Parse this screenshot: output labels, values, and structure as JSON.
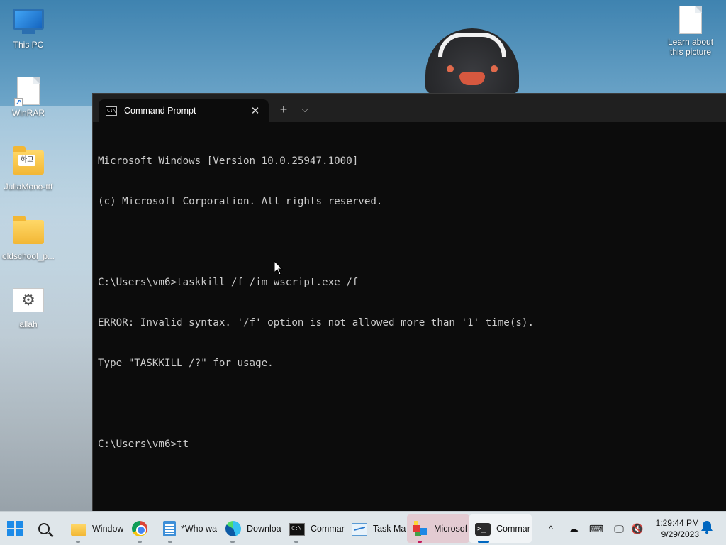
{
  "desktop": {
    "icons": [
      {
        "label": "This PC"
      },
      {
        "label": "WinRAR"
      },
      {
        "label": "JuliaMono-ttf",
        "badge": "하고"
      },
      {
        "label": "oldschool_p..."
      },
      {
        "label": "allah"
      },
      {
        "label": "Learn about this picture"
      }
    ]
  },
  "terminal": {
    "tab_title": "Command Prompt",
    "tab_icon_text": "C:\\",
    "new_tab_glyph": "+",
    "tab_menu_glyph": "⌵",
    "close_glyph": "✕",
    "lines": [
      "Microsoft Windows [Version 10.0.25947.1000]",
      "(c) Microsoft Corporation. All rights reserved.",
      "",
      "C:\\Users\\vm6>taskkill /f /im wscript.exe /f",
      "ERROR: Invalid syntax. '/f' option is not allowed more than '1' time(s).",
      "Type \"TASKKILL /?\" for usage.",
      "",
      "C:\\Users\\vm6>tt"
    ]
  },
  "taskbar": {
    "apps": [
      {
        "name": "file-explorer",
        "label": "Window"
      },
      {
        "name": "chrome",
        "label": ""
      },
      {
        "name": "notepad",
        "label": "*Who wa"
      },
      {
        "name": "edge",
        "label": "Downloa"
      },
      {
        "name": "command-prompt",
        "label": "Commar"
      },
      {
        "name": "task-manager",
        "label": "Task Ma"
      },
      {
        "name": "microsoft-app",
        "label": "Microsof"
      },
      {
        "name": "terminal",
        "label": "Commar"
      }
    ],
    "tray": {
      "overflow_glyph": "^",
      "time": "1:29:44 PM",
      "date": "9/29/2023"
    }
  }
}
